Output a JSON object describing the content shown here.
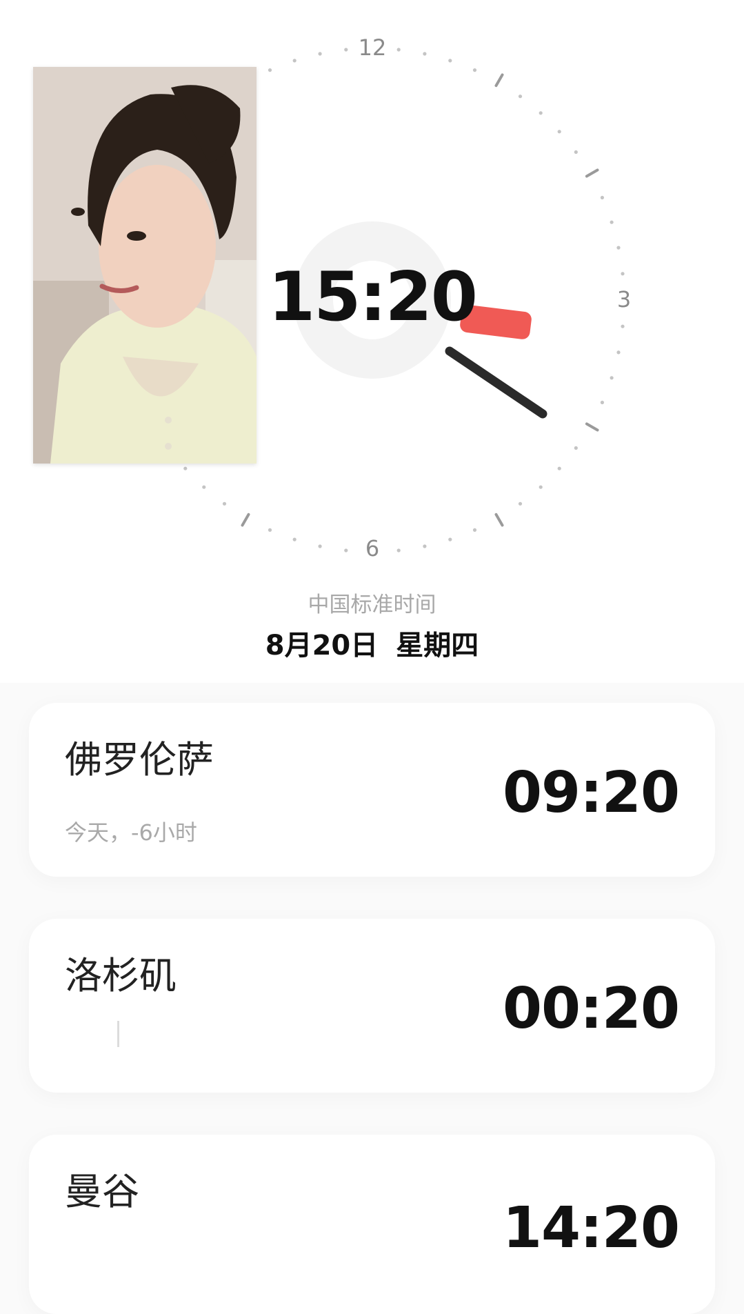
{
  "world_clock": {
    "main_time": "15:20",
    "dial_numbers": {
      "n12": "12",
      "n3": "3",
      "n6": "6"
    },
    "timezone_label": "中国标准时间",
    "date": "8月20日",
    "weekday": "星期四",
    "accent_color": "#f05a55",
    "hand_color": "#2a2a2a"
  },
  "cities": [
    {
      "name": "佛罗伦萨",
      "subtitle": "今天，-6小时",
      "time": "09:20"
    },
    {
      "name": "洛杉矶",
      "subtitle": "",
      "time": "00:20"
    },
    {
      "name": "曼谷",
      "subtitle": "",
      "time": "14:20"
    }
  ]
}
